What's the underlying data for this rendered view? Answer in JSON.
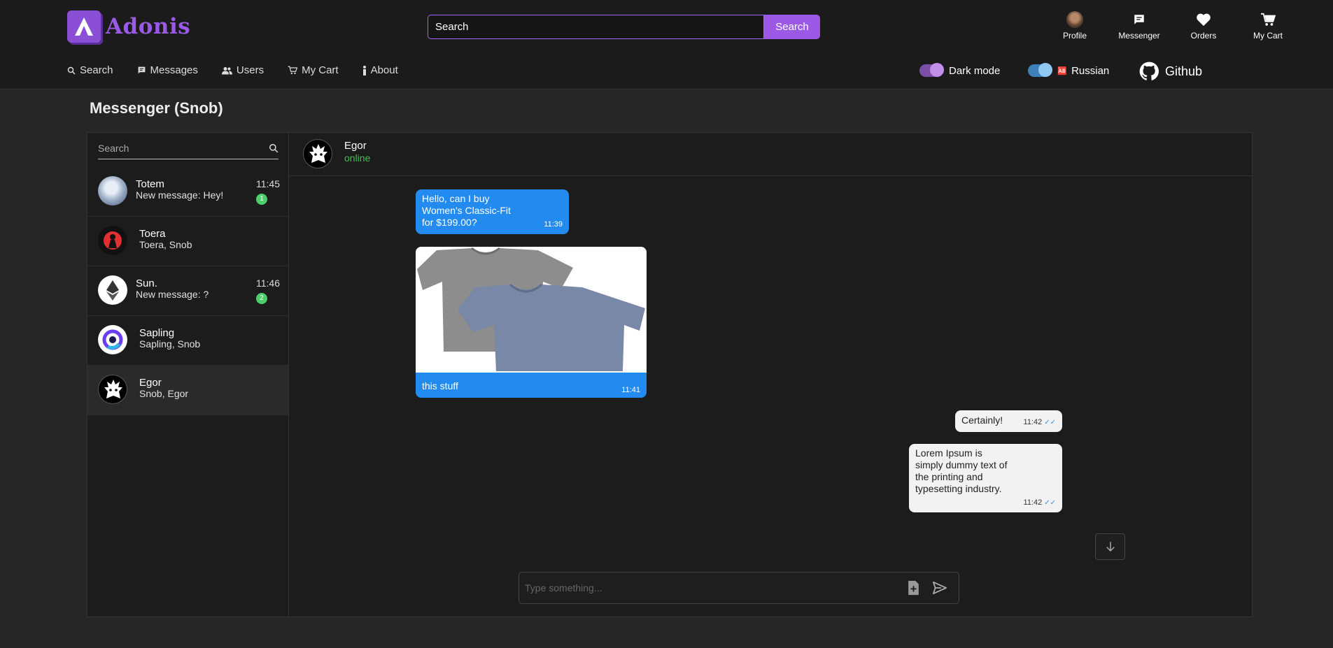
{
  "brand": {
    "name": "Adonis",
    "color": "#9a5ae8"
  },
  "header_search": {
    "placeholder": "Search",
    "button": "Search"
  },
  "top_icons": [
    {
      "label": "Profile",
      "icon": "avatar"
    },
    {
      "label": "Messenger",
      "icon": "chat-icon"
    },
    {
      "label": "Orders",
      "icon": "heart-icon"
    },
    {
      "label": "My Cart",
      "icon": "cart-icon"
    }
  ],
  "nav": [
    {
      "label": "Search",
      "icon": "search-icon"
    },
    {
      "label": "Messages",
      "icon": "chat-icon"
    },
    {
      "label": "Users",
      "icon": "users-icon"
    },
    {
      "label": "My Cart",
      "icon": "cart-icon"
    },
    {
      "label": "About",
      "icon": "info-icon"
    }
  ],
  "toggles": {
    "dark_mode": "Dark mode",
    "language": "Russian",
    "language_icon": "🆎"
  },
  "github": {
    "label": "Github"
  },
  "page_title": "Messenger (Snob)",
  "sidebar": {
    "search_placeholder": "Search",
    "chats": [
      {
        "name": "Totem",
        "message": "New message: Hey!",
        "time": "11:45",
        "unread": "1"
      },
      {
        "name": "Toera",
        "message": "Toera, Snob",
        "time": "",
        "unread": ""
      },
      {
        "name": "Sun.",
        "message": "New message: ?",
        "time": "11:46",
        "unread": "2"
      },
      {
        "name": "Sapling",
        "message": "Sapling, Snob",
        "time": "",
        "unread": ""
      },
      {
        "name": "Egor",
        "message": "Snob, Egor",
        "time": "",
        "unread": ""
      }
    ]
  },
  "chat": {
    "contact_name": "Egor",
    "status": "online",
    "messages": [
      {
        "direction": "in",
        "text": "Hello, can I buy Women's Classic-Fit for $199.00?",
        "time": "11:39"
      },
      {
        "direction": "in",
        "type": "image",
        "caption": "this stuff",
        "time": "11:41"
      },
      {
        "direction": "out",
        "text": "Certainly!",
        "time": "11:42",
        "read": "✓✓"
      },
      {
        "direction": "out",
        "text": "Lorem Ipsum is simply dummy text of the printing and typesetting industry.",
        "time": "11:42",
        "read": "✓✓"
      }
    ],
    "composer_placeholder": "Type something..."
  }
}
